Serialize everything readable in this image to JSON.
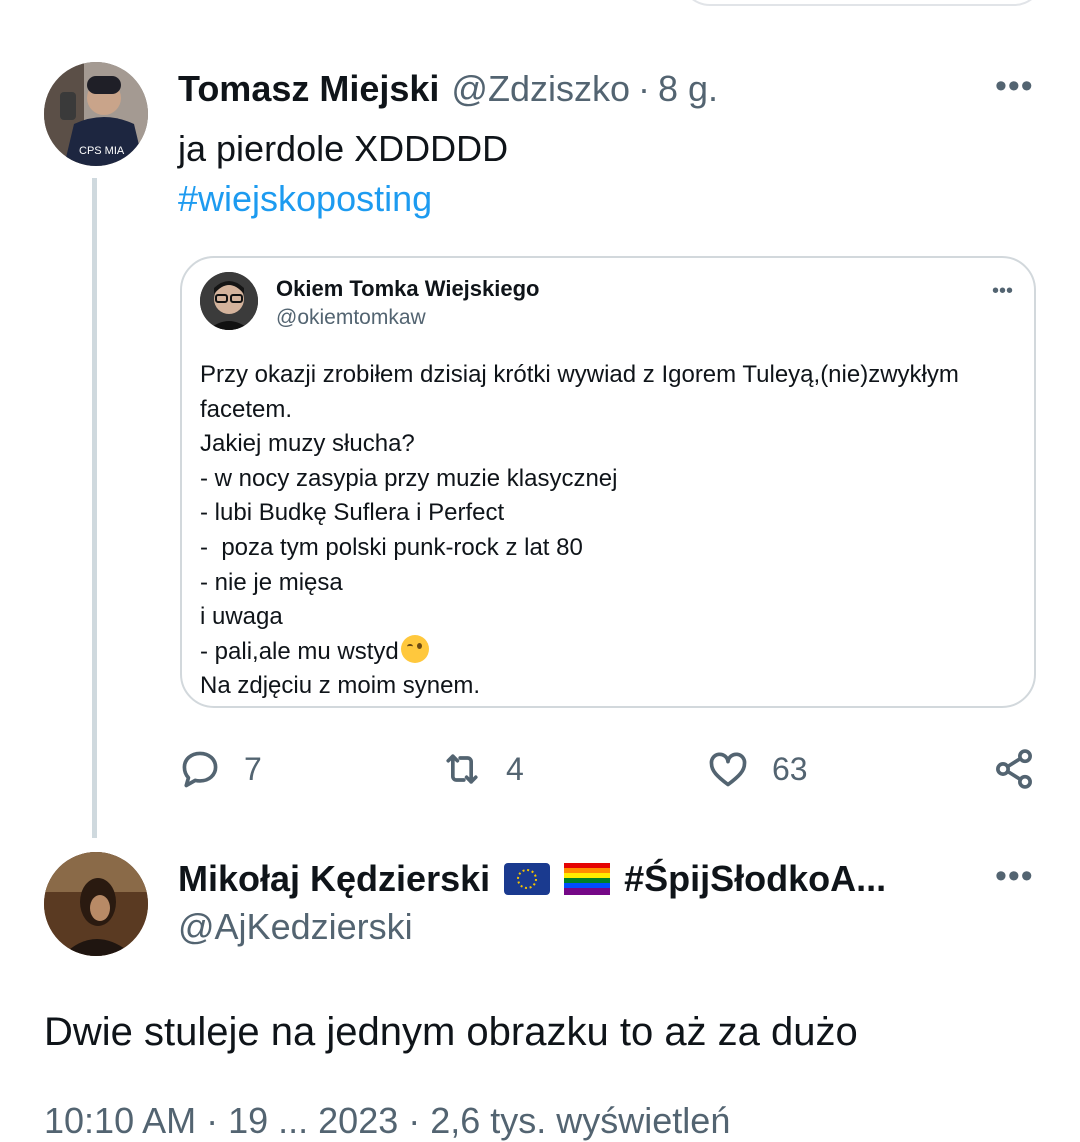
{
  "tweet": {
    "author_name": "Tomasz Miejski",
    "author_handle": "@Zdziszko",
    "separator": "·",
    "time": "8 g.",
    "text": "ja pierdole XDDDDD",
    "hashtag": "#wiejskoposting"
  },
  "quote": {
    "author_name": "Okiem Tomka Wiejskiego",
    "author_handle": "@okiemtomkaw",
    "lines": [
      "Przy okazji zrobiłem dzisiaj krótki wywiad z Igorem Tuleyą,(nie)zwykłym",
      "facetem.",
      "Jakiej muzy słucha?",
      "- w nocy zasypia przy muzie klasycznej",
      "- lubi Budkę Suflera i Perfect",
      "-  poza tym polski punk-rock z lat 80",
      "- nie je mięsa",
      "i uwaga",
      "- pali,ale mu wstyd",
      "Na zdjęciu z moim synem."
    ]
  },
  "actions": {
    "replies": "7",
    "retweets": "4",
    "likes": "63"
  },
  "reply": {
    "author_name": "Mikołaj Kędzierski",
    "author_suffix": "#ŚpijSłodkoA...",
    "author_handle": "@AjKedzierski",
    "text": "Dwie stuleje na jednym obrazku to aż za dużo",
    "timestamp": "10:10 AM · 19 ... 2023 · 2,6 tys. wyświetleń"
  },
  "icons": {
    "reply": "reply-icon",
    "retweet": "retweet-icon",
    "like": "heart-icon",
    "share": "share-icon",
    "more": "more-icon"
  },
  "colors": {
    "accent": "#1d9bf0",
    "secondary_text": "#536471",
    "thread_line": "#cfd9de"
  }
}
